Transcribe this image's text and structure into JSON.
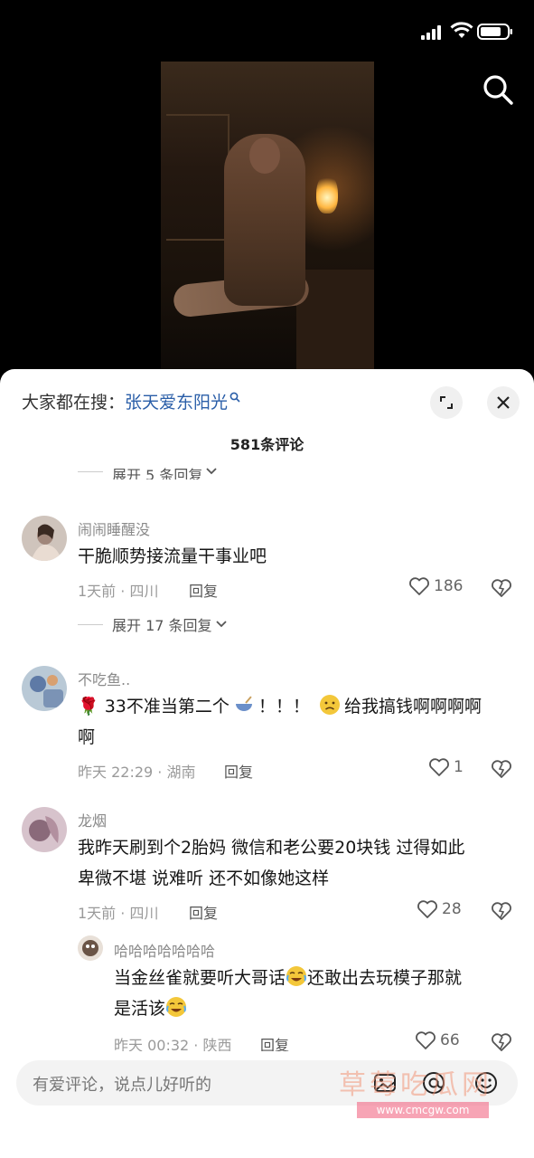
{
  "status_bar": {
    "icons": [
      "signal-icon",
      "wifi-icon",
      "battery-icon"
    ]
  },
  "top": {
    "search_icon": "search-icon"
  },
  "sheet": {
    "hot_search_label": "大家都在搜：",
    "hot_search_keyword": "张天爱东阳光",
    "comment_count": "581条评论",
    "partial_expand": "展开 5 条回复"
  },
  "comments": [
    {
      "user": "闹闹睡醒没",
      "text": "干脆顺势接流量干事业吧",
      "time": "1天前 · 四川",
      "reply": "回复",
      "likes": "186",
      "expand": "展开 17 条回复"
    },
    {
      "user": "不吃鱼..",
      "text_a": "33不准当第二个",
      "text_b": "！！！",
      "text_c": "给我搞钱啊啊啊啊",
      "text_d": "啊",
      "time": "昨天 22:29 · 湖南",
      "reply": "回复",
      "likes": "1"
    },
    {
      "user": "龙烟",
      "text_line1": "我昨天刷到个2胎妈 微信和老公要20块钱 过得如此",
      "text_line2": "卑微不堪 说难听 还不如像她这样",
      "time": "1天前 · 四川",
      "reply": "回复",
      "likes": "28"
    }
  ],
  "sub_reply": {
    "user": "哈哈哈哈哈哈哈",
    "text_a": "当金丝雀就要听大哥话",
    "text_b": "还敢出去玩模子那就",
    "text_c": "是活该",
    "time": "昨天 00:32 · 陕西",
    "reply": "回复",
    "likes": "66"
  },
  "input": {
    "placeholder": "有爱评论，说点儿好听的",
    "icons": [
      "image-icon",
      "at-icon",
      "emoji-icon"
    ]
  },
  "watermark": {
    "text": "草莓吃瓜网",
    "url": "www.cmcgw.com"
  }
}
